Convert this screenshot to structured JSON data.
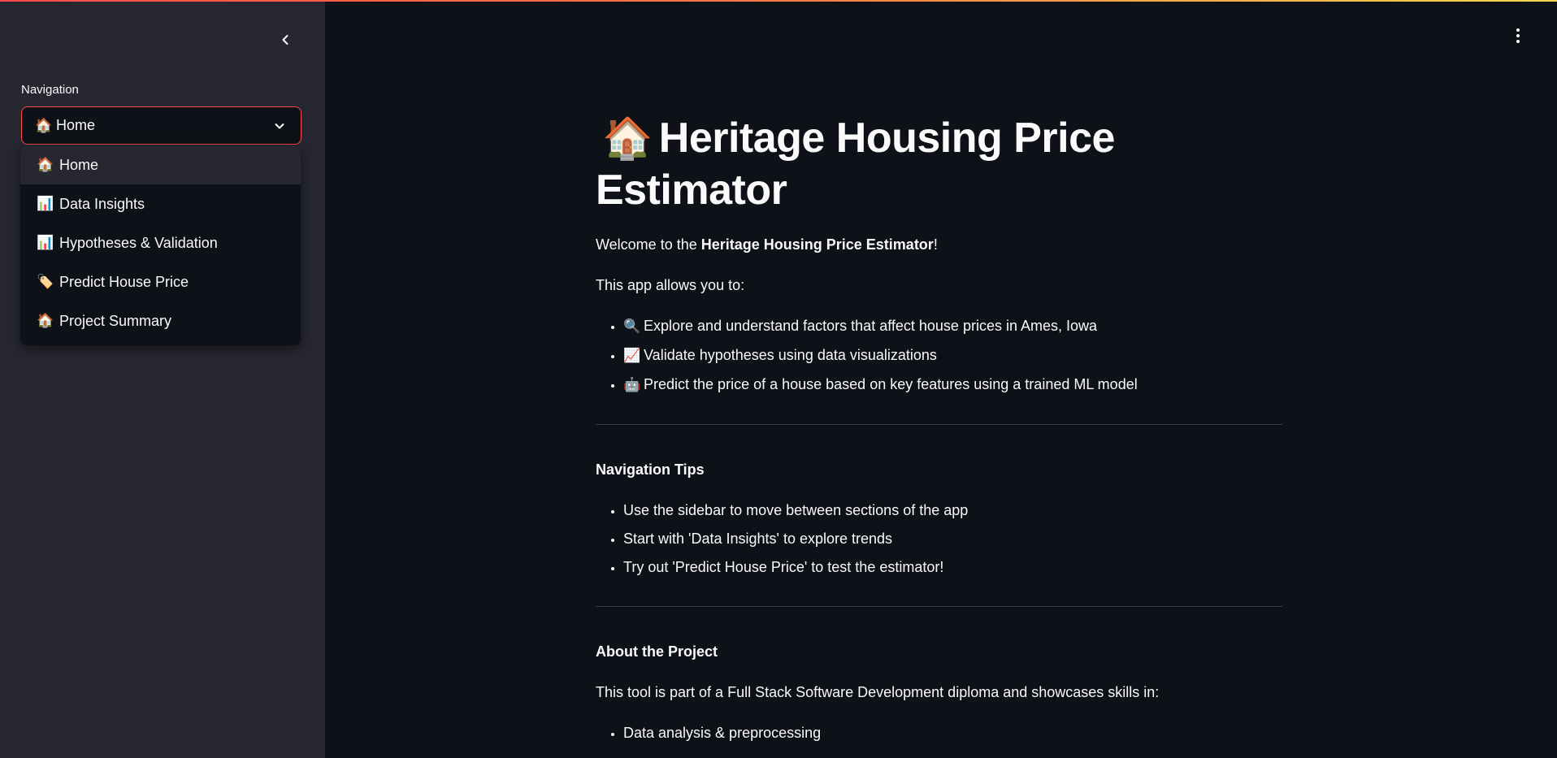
{
  "sidebar": {
    "nav_label": "Navigation",
    "selected": "Home",
    "selected_icon": "🏠",
    "options": [
      {
        "icon": "🏠",
        "label": "Home"
      },
      {
        "icon": "📊",
        "label": "Data Insights"
      },
      {
        "icon": "📊",
        "label": "Hypotheses & Validation"
      },
      {
        "icon": "🏷️",
        "label": "Predict House Price"
      },
      {
        "icon": "🏠",
        "label": "Project Summary"
      }
    ]
  },
  "main": {
    "title_icon": "🏠",
    "title": "Heritage Housing Price Estimator",
    "welcome_prefix": "Welcome to the ",
    "welcome_bold": "Heritage Housing Price Estimator",
    "welcome_suffix": "!",
    "allows_text": "This app allows you to:",
    "features": [
      {
        "icon": "🔍",
        "text": "Explore and understand factors that affect house prices in Ames, Iowa"
      },
      {
        "icon": "📈",
        "text": "Validate hypotheses using data visualizations"
      },
      {
        "icon": "🤖",
        "text": "Predict the price of a house based on key features using a trained ML model"
      }
    ],
    "nav_tips_heading": "Navigation Tips",
    "nav_tips": [
      "Use the sidebar to move between sections of the app",
      "Start with 'Data Insights' to explore trends",
      "Try out 'Predict House Price' to test the estimator!"
    ],
    "about_heading": "About the Project",
    "about_text": "This tool is part of a Full Stack Software Development diploma and showcases skills in:",
    "about_skills": [
      "Data analysis & preprocessing"
    ]
  },
  "colors": {
    "accent": "#ff4b4b",
    "background": "#0e1117",
    "sidebar_bg": "#262730"
  }
}
